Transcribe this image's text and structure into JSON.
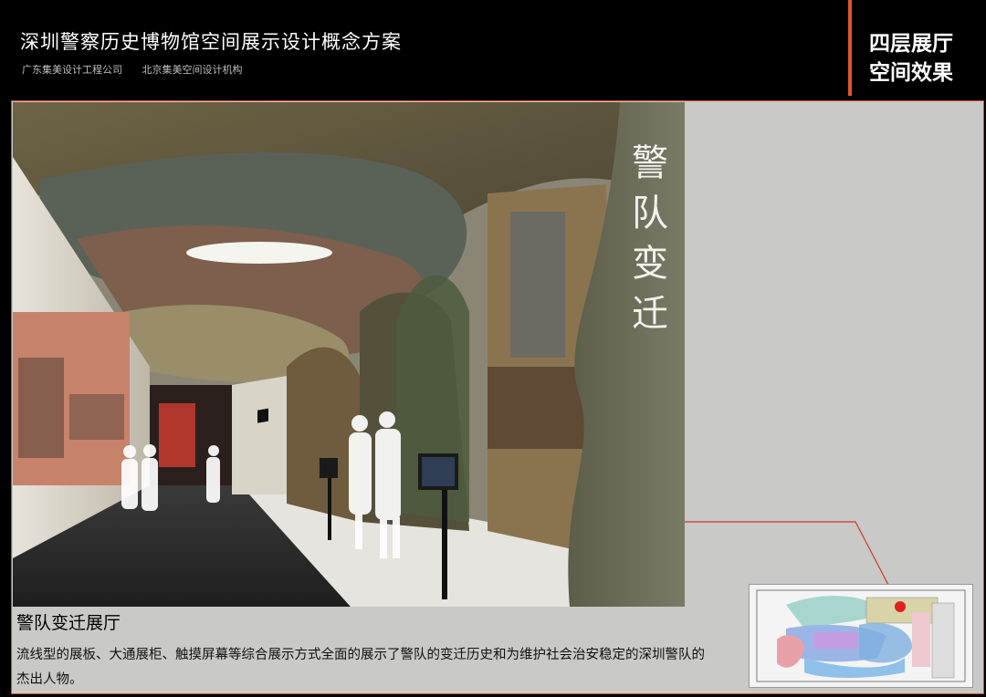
{
  "header": {
    "title": "深圳警察历史博物馆空间展示设计概念方案",
    "company_1": "广东集美设计工程公司",
    "company_2": "北京集美空间设计机构",
    "section_line1": "四层展厅",
    "section_line2": "空间效果"
  },
  "render": {
    "wall_text": "警队变迁"
  },
  "caption": {
    "title": "警队变迁展厅",
    "text": "流线型的展板、大通展柜、触摸屏幕等综合展示方式全面的展示了警队的变迁历史和为维护社会治安稳定的深圳警队的杰出人物。"
  },
  "colors": {
    "accent": "#e0572a",
    "panel_bg": "#c9c9c7",
    "header_bg": "#000000"
  }
}
